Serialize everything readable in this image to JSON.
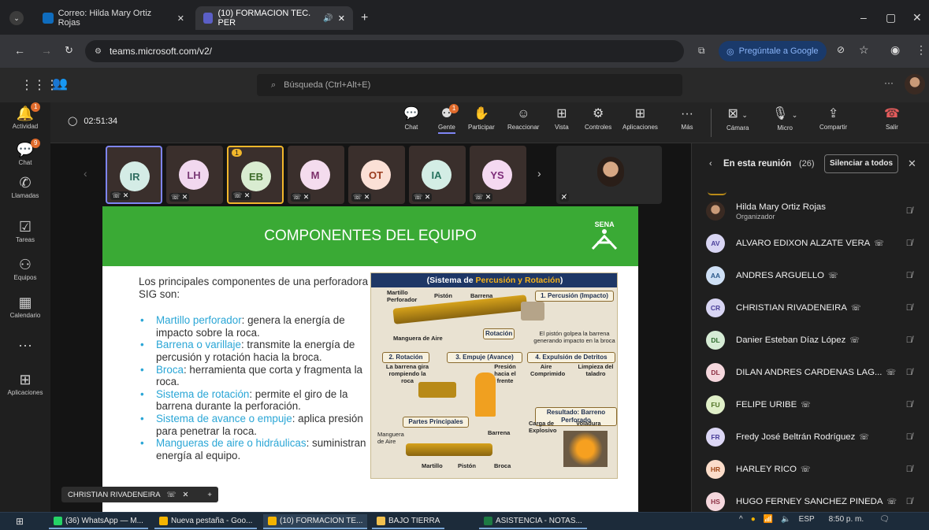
{
  "browser": {
    "tabs": [
      {
        "title": "Correo: Hilda Mary Ortiz Rojas",
        "active": false
      },
      {
        "title": "(10) FORMACION TEC. PER",
        "active": true
      }
    ],
    "url": "teams.microsoft.com/v2/",
    "ask_google": "Pregúntale a Google"
  },
  "teams": {
    "search_placeholder": "Búsqueda (Ctrl+Alt+E)",
    "rail": [
      {
        "label": "Actividad",
        "icon": "bell-icon",
        "badge": "1"
      },
      {
        "label": "Chat",
        "icon": "chat-icon",
        "badge": "9"
      },
      {
        "label": "Llamadas",
        "icon": "phone-icon",
        "badge": ""
      },
      {
        "label": "Tareas",
        "icon": "tasks-icon",
        "badge": ""
      },
      {
        "label": "Equipos",
        "icon": "teams-icon",
        "badge": ""
      },
      {
        "label": "Calendario",
        "icon": "calendar-icon",
        "badge": ""
      },
      {
        "label": "...",
        "icon": "more-icon",
        "badge": ""
      },
      {
        "label": "Aplicaciones",
        "icon": "apps-icon",
        "badge": ""
      }
    ],
    "timer": "02:51:34",
    "toolbar": [
      {
        "label": "Chat",
        "icon": "chat-icon",
        "badge": ""
      },
      {
        "label": "Gente",
        "icon": "people-icon",
        "badge": "1"
      },
      {
        "label": "Participar",
        "icon": "raise-hand-icon",
        "badge": ""
      },
      {
        "label": "Reaccionar",
        "icon": "emoji-icon",
        "badge": ""
      },
      {
        "label": "Vista",
        "icon": "view-icon",
        "badge": ""
      },
      {
        "label": "Controles",
        "icon": "controls-icon",
        "badge": ""
      },
      {
        "label": "Aplicaciones",
        "icon": "apps-icon",
        "badge": ""
      },
      {
        "label": "Más",
        "icon": "more-icon",
        "badge": ""
      }
    ],
    "av_controls": [
      {
        "label": "Cámara",
        "icon": "camera-off-icon"
      },
      {
        "label": "Micro",
        "icon": "mic-off-icon"
      },
      {
        "label": "Compartir",
        "icon": "share-icon"
      },
      {
        "label": "Salir",
        "icon": "hangup-icon"
      }
    ]
  },
  "participants_strip": [
    {
      "initials": "IR",
      "bg": "#d4ece6",
      "fg": "#2e6c5f",
      "hand": ""
    },
    {
      "initials": "LH",
      "bg": "#f1d8ef",
      "fg": "#7a3a76",
      "hand": ""
    },
    {
      "initials": "EB",
      "bg": "#d9ecd1",
      "fg": "#3d6b2a",
      "hand": "1"
    },
    {
      "initials": "M",
      "bg": "#f4dcee",
      "fg": "#7c2f6a",
      "hand": ""
    },
    {
      "initials": "OT",
      "bg": "#fbe0d6",
      "fg": "#9a3b1e",
      "hand": ""
    },
    {
      "initials": "IA",
      "bg": "#d3ede5",
      "fg": "#27725e",
      "hand": ""
    },
    {
      "initials": "YS",
      "bg": "#f4d9f1",
      "fg": "#7d2c79",
      "hand": ""
    }
  ],
  "slide": {
    "title": "COMPONENTES DEL EQUIPO",
    "logo": "SENA",
    "intro": "Los principales componentes de una perforadora SIG son:",
    "bullets": [
      {
        "term": "Martillo perforador",
        "rest": ": genera la energía de impacto sobre la roca."
      },
      {
        "term": "Barrena o varillaje",
        "rest": ": transmite la energía de percusión y rotación hacia la broca."
      },
      {
        "term": "Broca",
        "rest": ": herramienta que corta y fragmenta la roca."
      },
      {
        "term": "Sistema de rotación",
        "rest": ": permite el giro de la barrena durante la perforación."
      },
      {
        "term": "Sistema de avance o empuje",
        "rest": ": aplica presión para penetrar la roca."
      },
      {
        "term": "Mangueras de aire o hidráulicas",
        "rest": ": suministran energía al equipo."
      }
    ],
    "infographic": {
      "header_a": "(Sistema de ",
      "header_b": "Percusión y Rotación",
      "header_c": ")",
      "labels": {
        "martillo": "Martillo Perforador",
        "piston": "Pistón",
        "barrena": "Barrena",
        "manguera_aire": "Manguera de Aire",
        "rotacion": "Rotación",
        "p1": "1. Percusión (Impacto)",
        "p1_desc": "El pistón golpea la barrena generando impacto en la broca",
        "p2": "2. Rotación",
        "p2_desc": "La barrena gira rompiendo la roca",
        "p3": "3. Empuje (Avance)",
        "p3_desc": "Presión hacia el frente",
        "p4": "4. Expulsión de Detritos",
        "p4_aire": "Aire Comprimido",
        "p4_limp": "Limpieza del taladro",
        "resultado": "Resultado: Barreno Perforado",
        "partes": "Partes Principales",
        "carga": "Carga de Explosivo",
        "voladura": "Voladura",
        "mangera2": "Manguera de Aire",
        "barrena2": "Barrena",
        "martillo2": "Martillo",
        "piston2": "Pistón",
        "broca": "Broca"
      }
    }
  },
  "presenter_label": "CHRISTIAN RIVADENEIRA",
  "panel": {
    "title": "En esta reunión",
    "count": "(26)",
    "mute_all": "Silenciar a todos",
    "people": [
      {
        "initials": "",
        "name": "Hilda Mary Ortiz Rojas",
        "role": "Organizador",
        "bg": "#555",
        "fg": "#fff",
        "phone": false
      },
      {
        "initials": "AV",
        "name": "ALVARO EDIXON ALZATE VERA",
        "role": "",
        "bg": "#d8d5f3",
        "fg": "#4a3f9a",
        "phone": true
      },
      {
        "initials": "AA",
        "name": "ANDRES ARGUELLO",
        "role": "",
        "bg": "#cfe0f5",
        "fg": "#2d5a8c",
        "phone": true
      },
      {
        "initials": "CR",
        "name": "CHRISTIAN RIVADENEIRA",
        "role": "",
        "bg": "#d8d5f3",
        "fg": "#4a3f9a",
        "phone": true
      },
      {
        "initials": "DL",
        "name": "Danier Esteban Díaz López",
        "role": "",
        "bg": "#d6ecd5",
        "fg": "#2f6b2e",
        "phone": true
      },
      {
        "initials": "DL",
        "name": "DILAN ANDRES CARDENAS LAG...",
        "role": "",
        "bg": "#f5d7dd",
        "fg": "#8c2f42",
        "phone": true
      },
      {
        "initials": "FU",
        "name": "FELIPE URIBE",
        "role": "",
        "bg": "#e0efc8",
        "fg": "#4f7224",
        "phone": true
      },
      {
        "initials": "FR",
        "name": "Fredy José Beltrán Rodríguez",
        "role": "",
        "bg": "#dcd7f5",
        "fg": "#4a3f9a",
        "phone": true
      },
      {
        "initials": "HR",
        "name": "HARLEY RICO",
        "role": "",
        "bg": "#fbdcc9",
        "fg": "#a04818",
        "phone": true
      },
      {
        "initials": "HS",
        "name": "HUGO FERNEY SANCHEZ PINEDA",
        "role": "",
        "bg": "#f5d7dd",
        "fg": "#8c2f42",
        "phone": true
      }
    ]
  },
  "taskbar": {
    "items": [
      {
        "label": "(36) WhatsApp — M...",
        "color": "#25d366"
      },
      {
        "label": "Nueva pestaña - Goo...",
        "color": "#f4b400"
      },
      {
        "label": "(10) FORMACION TE...",
        "color": "#f4b400"
      },
      {
        "label": "BAJO TIERRA",
        "color": "#f2c14e"
      },
      {
        "label": "ASISTENCIA - NOTAS...",
        "color": "#1d7a43"
      }
    ],
    "lang": "ESP",
    "time": "8:50 p. m."
  }
}
